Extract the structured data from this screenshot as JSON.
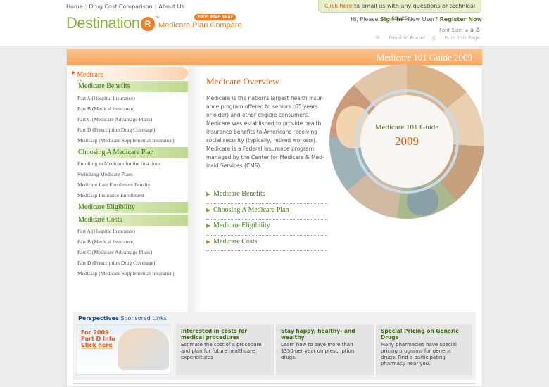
{
  "topnav": {
    "home": "Home",
    "compare": "Drug Cost Comparison",
    "about": "About Us"
  },
  "notice": {
    "link": "Click here",
    "rest": " to email us with any questions or technical issues."
  },
  "brand": {
    "name": "Destination",
    "mark": "R",
    "tm": "™",
    "subtitle": "Medicare Plan Compare",
    "plan_year": "2009 Plan Year"
  },
  "user": {
    "greeting": "Hi, Please ",
    "signin": "Sign-In",
    "sep": " | New User? ",
    "register": "Register Now"
  },
  "fontsize": {
    "label": "Font Size:",
    "small": "a",
    "med": "a",
    "large": "a"
  },
  "tools": {
    "email": "Email to Friend",
    "print": "Print this Page"
  },
  "banner": {
    "title": "Medicare 101 Guide 2009"
  },
  "sidebar": {
    "active": "Medicare Overview",
    "benefits": {
      "title": "Medicare Benefits",
      "items": [
        "Part A (Hospital Insurance)",
        "Part B (Medical Insurance)",
        "Part C (Medicare Advantage Plans)",
        "Part D (Prescription Drug Coverage)",
        "MediGap (Medicare Supplemental Insurance)"
      ]
    },
    "choosing": {
      "title": "Choosing A Medicare Plan",
      "items": [
        "Enrolling in Medicare for the first time",
        "Switching Medicare Plans",
        "Medicare Late Enrollment Penalty",
        "MediGap Insurance Enrollment"
      ]
    },
    "eligibility": {
      "title": "Medicare Eligibility"
    },
    "costs": {
      "title": "Medicare Costs",
      "items": [
        "Part A (Hospital Insurance)",
        "Part B (Medical Insurance)",
        "Part C (Medicare Advantage Plans)",
        "Part D (Prescription Drug Coverage)",
        "MediGap (Medicare Supplemental Insurance)"
      ]
    }
  },
  "main": {
    "title": "Medicare Overview",
    "lines": [
      "Medicare is the nation's largest health insur-",
      "ance program offered to seniors (65 years",
      "or older) and other eligible consumers.",
      "Medicare was established to provide health",
      "insurance benefits to Americans receiving",
      "social security (typically, retired workers).",
      "Medicare is a Federal insurance program,",
      "managed by the Center for Medicare & Med-",
      "icaid Services (CMS)."
    ],
    "links": [
      "Medicare Benefits",
      "Choosing A Medicare Plan",
      "Medicare Eligibility",
      "Medicare Costs"
    ]
  },
  "circle": {
    "line1": "Medicare 101 Guide",
    "line2": "2009"
  },
  "sponsored": {
    "title_bold": "Perspectives",
    "title_rest": " Sponsored Links",
    "promo": {
      "text": "For 2009 Part D Info ",
      "link": "Click here"
    },
    "cards": [
      {
        "title": [
          "Interested in costs for",
          "medical procedures"
        ],
        "body": [
          "Estimate the cost of a procedure",
          "and plan for future healthcare",
          "expenditures"
        ]
      },
      {
        "title": [
          "Stay happy, healthy- and",
          "wealthy"
        ],
        "body": [
          "Learn how to save more than",
          "$350 per year on prescription",
          "drugs."
        ]
      },
      {
        "title": [
          "Special Pricing on Generic",
          "Drugs"
        ],
        "body": [
          "Many pharmacies have special",
          "pricing programs for generic",
          "drugs. Find a participating",
          "pharmacy near you."
        ]
      }
    ]
  },
  "colors": {
    "accent": "#e35a0e",
    "green": "#4a7b1a",
    "banner": "#f8a660"
  }
}
